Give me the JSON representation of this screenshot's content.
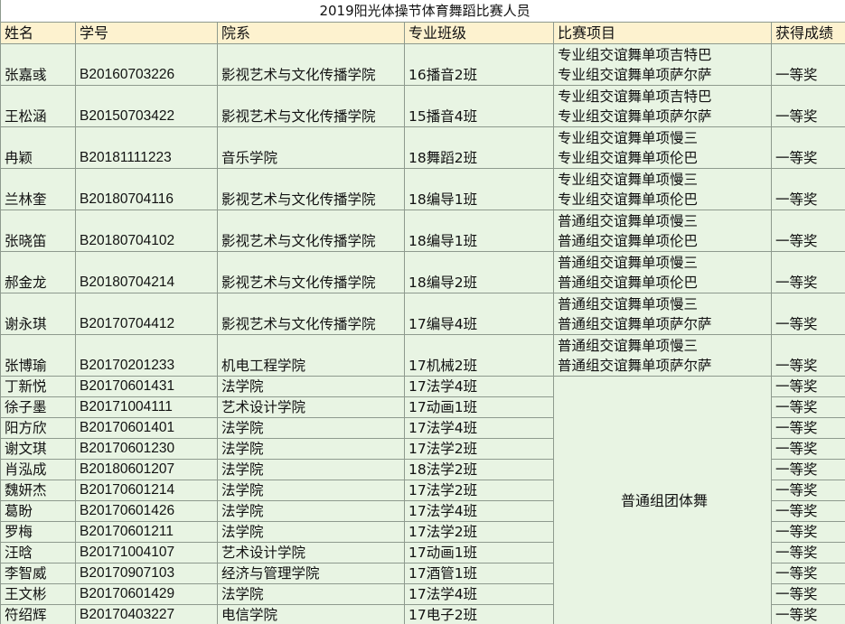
{
  "sheet": {
    "title": "2019阳光体操节体育舞蹈比赛人员",
    "headers": [
      "姓名",
      "学号",
      "院系",
      "专业班级",
      "比赛项目",
      "获得成绩"
    ],
    "group_event": "普通组团体舞",
    "rows": [
      {
        "name": "张嘉彧",
        "id": "B20160703226",
        "college": "影视艺术与文化传播学院",
        "class": "16播音2班",
        "event1": "专业组交谊舞单项吉特巴",
        "event2": "专业组交谊舞单项萨尔萨",
        "award": "一等奖"
      },
      {
        "name": "王松涵",
        "id": "B20150703422",
        "college": "影视艺术与文化传播学院",
        "class": "15播音4班",
        "event1": "专业组交谊舞单项吉特巴",
        "event2": "专业组交谊舞单项萨尔萨",
        "award": "一等奖"
      },
      {
        "name": "冉颖",
        "id": "B20181111223",
        "college": "音乐学院",
        "class": "18舞蹈2班",
        "event1": "专业组交谊舞单项慢三",
        "event2": "专业组交谊舞单项伦巴",
        "award": "一等奖"
      },
      {
        "name": "兰林奎",
        "id": "B20180704116",
        "college": "影视艺术与文化传播学院",
        "class": "18编导1班",
        "event1": "专业组交谊舞单项慢三",
        "event2": "专业组交谊舞单项伦巴",
        "award": "一等奖"
      },
      {
        "name": "张晓笛",
        "id": "B20180704102",
        "college": "影视艺术与文化传播学院",
        "class": "18编导1班",
        "event1": "普通组交谊舞单项慢三",
        "event2": "普通组交谊舞单项伦巴",
        "award": "一等奖"
      },
      {
        "name": "郝金龙",
        "id": "B20180704214",
        "college": "影视艺术与文化传播学院",
        "class": "18编导2班",
        "event1": "普通组交谊舞单项慢三",
        "event2": "普通组交谊舞单项伦巴",
        "award": "一等奖"
      },
      {
        "name": "谢永琪",
        "id": "B20170704412",
        "college": "影视艺术与文化传播学院",
        "class": "17编导4班",
        "event1": "普通组交谊舞单项慢三",
        "event2": "普通组交谊舞单项萨尔萨",
        "award": "一等奖"
      },
      {
        "name": "张博瑜",
        "id": "B20170201233",
        "college": "机电工程学院",
        "class": "17机械2班",
        "event1": "普通组交谊舞单项慢三",
        "event2": "普通组交谊舞单项萨尔萨",
        "award": "一等奖"
      }
    ],
    "group_rows": [
      {
        "name": "丁新悦",
        "id": "B20170601431",
        "college": "法学院",
        "class": "17法学4班",
        "award": "一等奖"
      },
      {
        "name": "徐子墨",
        "id": "B20171004111",
        "college": "艺术设计学院",
        "class": "17动画1班",
        "award": "一等奖"
      },
      {
        "name": "阳方欣",
        "id": "B20170601401",
        "college": "法学院",
        "class": "17法学4班",
        "award": "一等奖"
      },
      {
        "name": "谢文琪",
        "id": "B20170601230",
        "college": "法学院",
        "class": "17法学2班",
        "award": "一等奖"
      },
      {
        "name": "肖泓成",
        "id": "B20180601207",
        "college": "法学院",
        "class": "18法学2班",
        "award": "一等奖"
      },
      {
        "name": "魏妍杰",
        "id": "B20170601214",
        "college": "法学院",
        "class": "17法学2班",
        "award": "一等奖"
      },
      {
        "name": "葛盼",
        "id": "B20170601426",
        "college": "法学院",
        "class": "17法学4班",
        "award": "一等奖"
      },
      {
        "name": "罗梅",
        "id": "B20170601211",
        "college": "法学院",
        "class": "17法学2班",
        "award": "一等奖"
      },
      {
        "name": "汪晗",
        "id": "B20171004107",
        "college": "艺术设计学院",
        "class": "17动画1班",
        "award": "一等奖"
      },
      {
        "name": "李智威",
        "id": "B20170907103",
        "college": "经济与管理学院",
        "class": "17酒管1班",
        "award": "一等奖"
      },
      {
        "name": "王文彬",
        "id": "B20170601429",
        "college": "法学院",
        "class": "17法学4班",
        "award": "一等奖"
      },
      {
        "name": "符绍辉",
        "id": "B20170403227",
        "college": "电信学院",
        "class": "17电子2班",
        "award": "一等奖"
      }
    ]
  }
}
